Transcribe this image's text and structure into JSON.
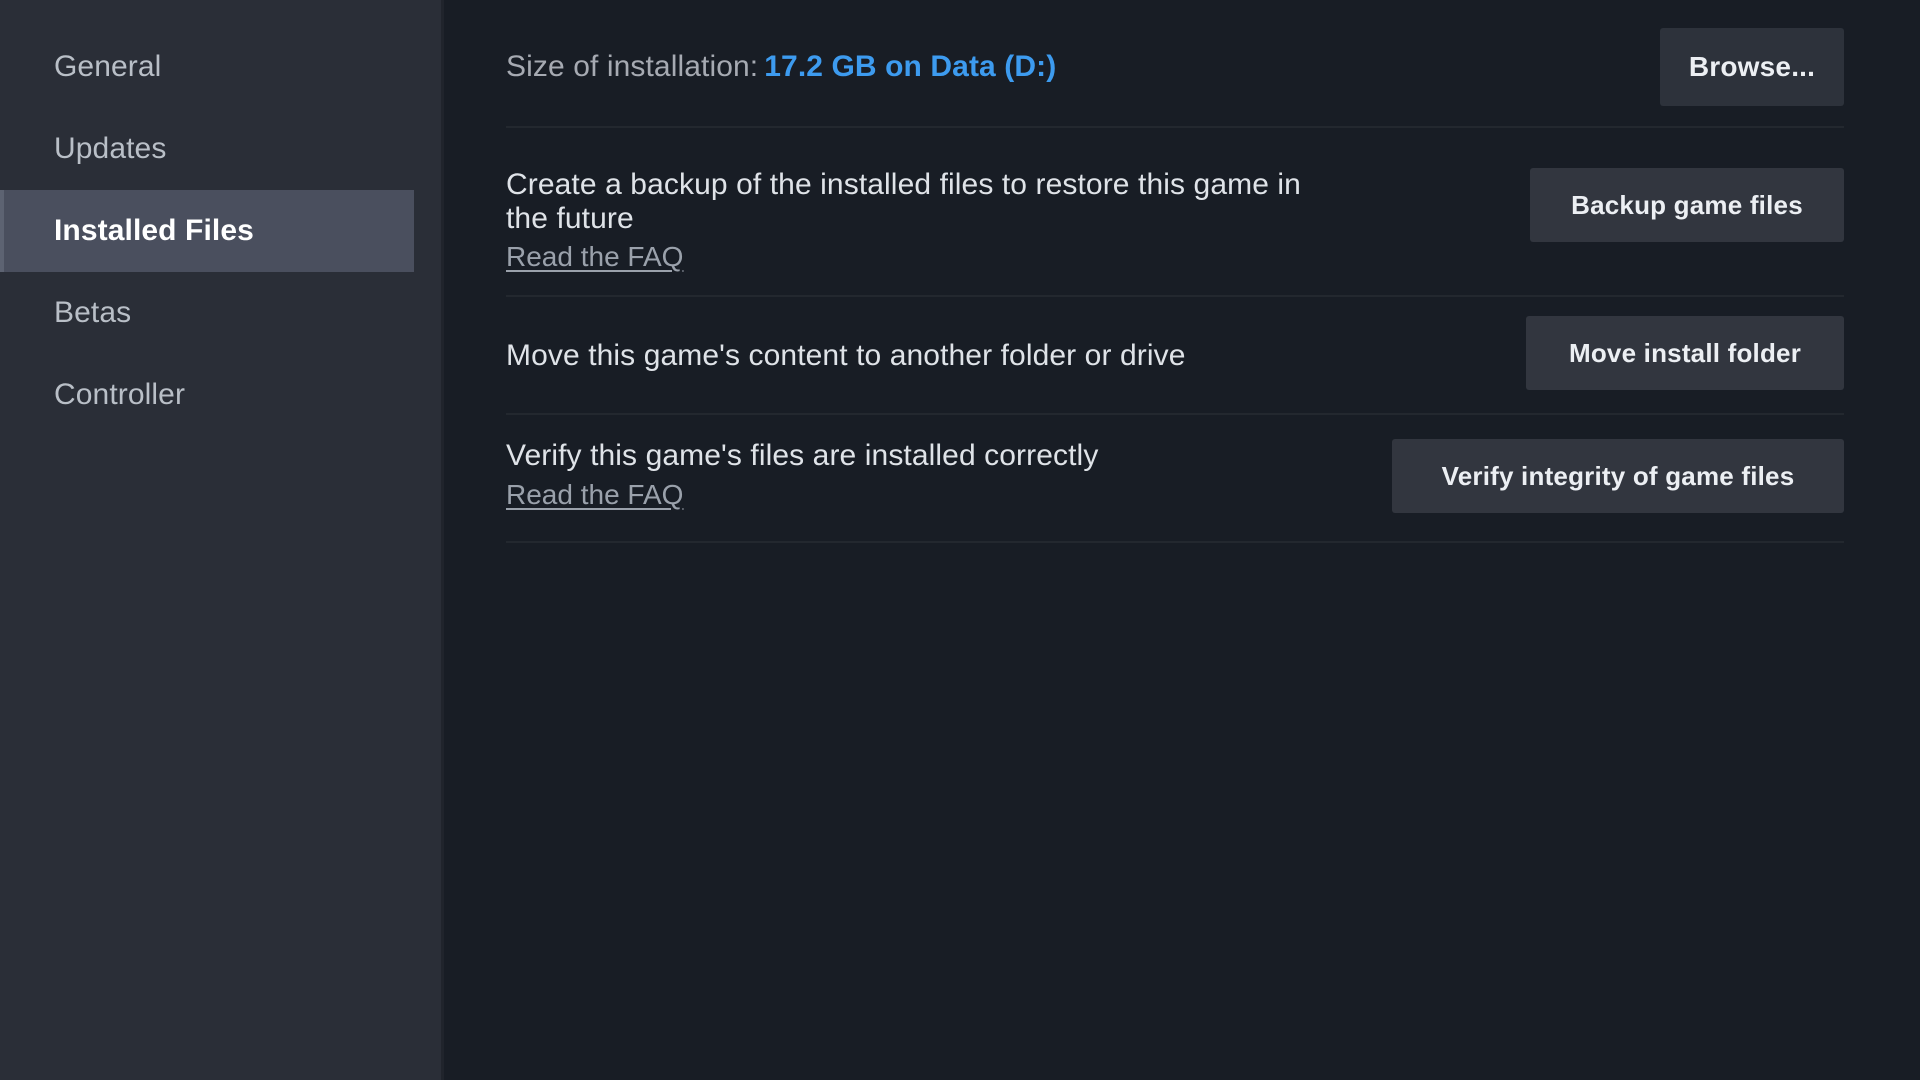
{
  "sidebar": {
    "items": [
      {
        "label": "General",
        "selected": false
      },
      {
        "label": "Updates",
        "selected": false
      },
      {
        "label": "Installed Files",
        "selected": true
      },
      {
        "label": "Betas",
        "selected": false
      },
      {
        "label": "Controller",
        "selected": false
      }
    ]
  },
  "main": {
    "size": {
      "label": "Size of installation:",
      "value": "17.2 GB on Data (D:)",
      "value_color": "#3d9bef",
      "browse_button": "Browse..."
    },
    "rows": [
      {
        "title": "Create a backup of the installed files to restore this game in the future",
        "link": "Read the FAQ",
        "button": "Backup game files"
      },
      {
        "title": "Move this game's content to another folder or drive",
        "link": "",
        "button": "Move install folder"
      },
      {
        "title": "Verify this game's files are installed correctly",
        "link": "Read the FAQ",
        "button": "Verify integrity of game files"
      }
    ]
  },
  "colors": {
    "sidebar_bg": "#2a2e37",
    "main_bg": "#181d25",
    "selected_bg": "#4a4f5e",
    "button_bg": "#32363f",
    "accent_blue": "#3d9bef",
    "divider": "#23282f"
  }
}
